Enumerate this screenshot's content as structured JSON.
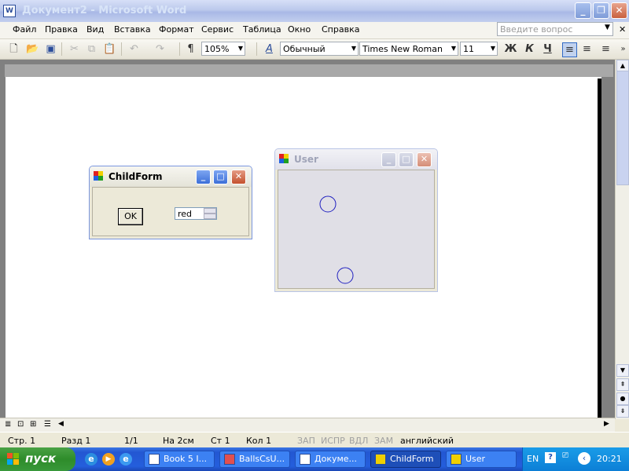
{
  "app": {
    "title": "Документ2 - Microsoft Word",
    "word_icon_glyph": "W"
  },
  "menu": [
    "Файл",
    "Правка",
    "Вид",
    "Вставка",
    "Формат",
    "Сервис",
    "Таблица",
    "Окно",
    "Справка"
  ],
  "help_box": {
    "placeholder": "Введите вопрос"
  },
  "toolbar": {
    "zoom": "105%",
    "style": "Обычный",
    "font": "Times New Roman",
    "size": "11",
    "bold": "Ж",
    "italic": "К",
    "underline": "Ч",
    "paragraph_mark": "¶"
  },
  "child_form": {
    "title": "ChildForm",
    "ok_label": "OK",
    "color_value": "red"
  },
  "user_form": {
    "title": "User",
    "circle_color": "#2020c0"
  },
  "status": {
    "page": "Стр. 1",
    "section": "Разд 1",
    "pages": "1/1",
    "at": "На 2см",
    "line": "Ст 1",
    "col": "Кол 1",
    "rec": "ЗАП",
    "trk": "ИСПР",
    "ext": "ВДЛ",
    "ovr": "ЗАМ",
    "lang": "английский"
  },
  "taskbar": {
    "start": "пуск",
    "buttons": [
      {
        "label": "Book 5 I..."
      },
      {
        "label": "BallsCsU..."
      },
      {
        "label": "Докуме..."
      },
      {
        "label": "ChildForm"
      },
      {
        "label": "User"
      }
    ],
    "lang": "EN",
    "clock": "20:21"
  },
  "colors": {
    "taskbar_blue": "#245edc",
    "start_green": "#38983a",
    "desktop_grey": "#808080"
  }
}
